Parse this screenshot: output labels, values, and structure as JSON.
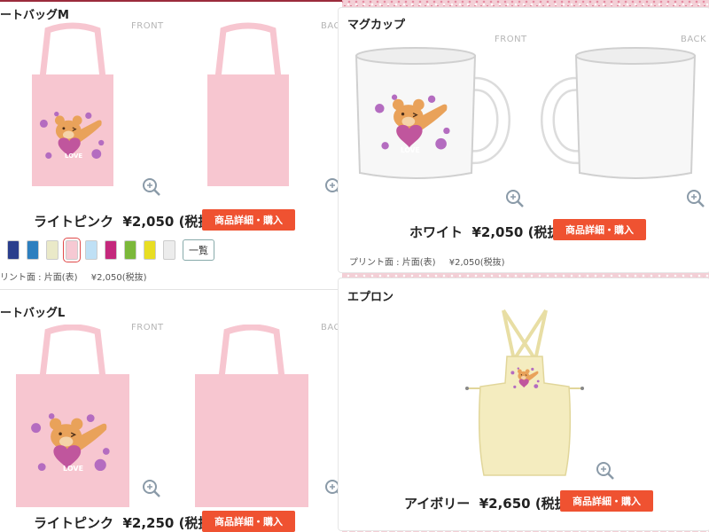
{
  "tote_m": {
    "title": "ートバッグM",
    "front_label": "FRONT",
    "back_label": "BAC",
    "color_name": "ライトピンク",
    "price": "¥2,050 (税抜)",
    "buy_label": "商品詳細・購入",
    "list_label": "一覧",
    "print_side": "リント面 : 片面(表)",
    "print_price": "¥2,050(税抜)",
    "swatch_colors": [
      "#2a3e8c",
      "#2d7fbf",
      "#eae9c8",
      "#f6c9d3",
      "#bfe0f5",
      "#c4287c",
      "#7bb83a",
      "#e8de23",
      "#ececec"
    ],
    "selected_swatch": 3,
    "bag_color": "#f7c6d0"
  },
  "tote_l": {
    "title": "ートバッグL",
    "front_label": "FRONT",
    "back_label": "BAC",
    "color_name": "ライトピンク",
    "price": "¥2,250 (税抜)",
    "buy_label": "商品詳細・購入"
  },
  "mug": {
    "title": "マグカップ",
    "front_label": "FRONT",
    "back_label": "BACK",
    "color_name": "ホワイト",
    "price": "¥2,050 (税抜)",
    "buy_label": "商品詳細・購入",
    "print_side": "プリント面 : 片面(表)",
    "print_price": "¥2,050(税抜)"
  },
  "apron": {
    "title": "エプロン",
    "color_name": "アイボリー",
    "price": "¥2,650 (税抜)",
    "buy_label": "商品詳細・購入",
    "apron_color": "#f4ecbf"
  },
  "design": {
    "love_text": "LOVE"
  },
  "colors": {
    "accent": "#ef5231",
    "bear": "#e9a25a",
    "heart": "#c0569d",
    "dots": "#b46cc0"
  }
}
